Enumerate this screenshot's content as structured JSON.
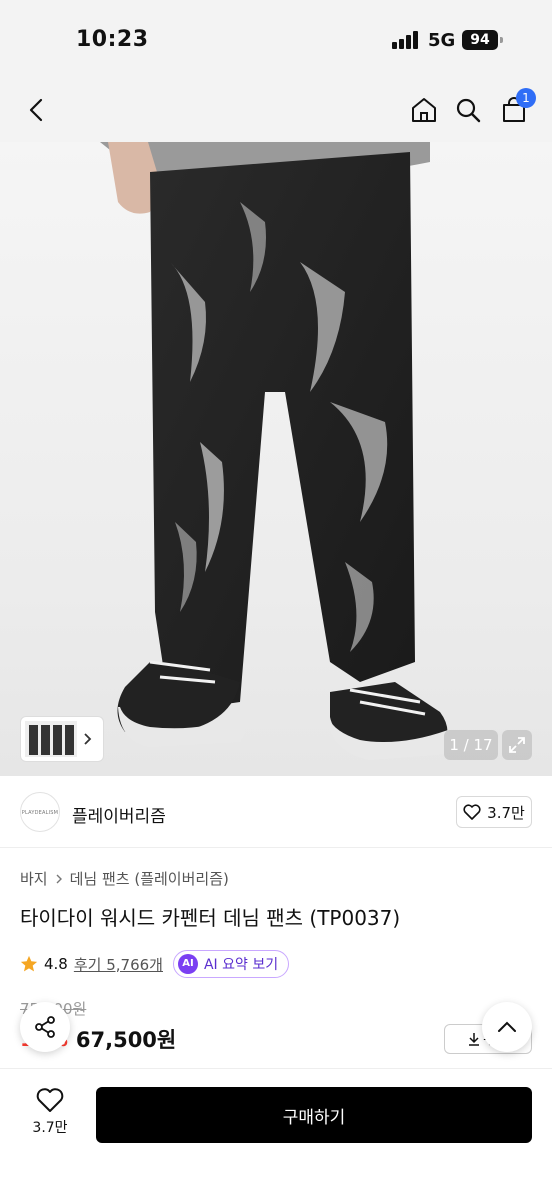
{
  "status_bar": {
    "time": "10:23",
    "network": "5G",
    "battery": "94"
  },
  "nav": {
    "cart_count": "1",
    "icons": [
      "back-icon",
      "home-icon",
      "search-icon",
      "cart-icon"
    ]
  },
  "gallery": {
    "counter": "1 / 17"
  },
  "brand": {
    "logo_text": "PLAYDEALISM",
    "name": "플레이버리즘",
    "likes": "3.7만"
  },
  "breadcrumb": {
    "level1": "바지",
    "level2": "데님 팬츠 (플레이버리즘)"
  },
  "product": {
    "title": "타이다이 워시드 카펜터 데님 팬츠 (TP0037)",
    "rating": "4.8",
    "reviews": "후기 5,766개",
    "ai_summary": "AI 요약 보기",
    "ai_badge": "AI",
    "original_price": "75,000원",
    "discount": "10%",
    "sale_price": "67,500원",
    "coupon_label": "쿠폰"
  },
  "bottom_bar": {
    "wish_count": "3.7만",
    "buy_label": "구매하기"
  },
  "colors": {
    "accent_blue": "#2f6df6",
    "ai_purple": "#7b3ff2",
    "discount_red": "#ff3b30",
    "buy_black": "#000000"
  }
}
